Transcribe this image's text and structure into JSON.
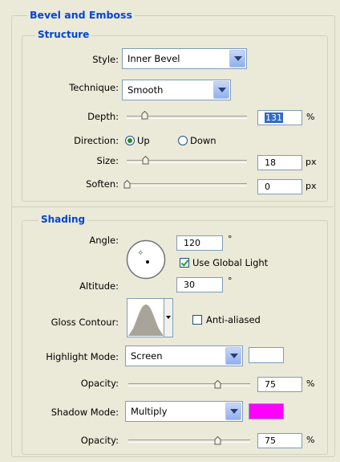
{
  "bevel": {
    "title": "Bevel and Emboss",
    "structure": {
      "title": "Structure",
      "style": {
        "label": "Style:",
        "value": "Inner Bevel"
      },
      "technique": {
        "label": "Technique:",
        "value": "Smooth"
      },
      "depth": {
        "label": "Depth:",
        "value": "131",
        "unit": "%",
        "slider_fraction": 0.2
      },
      "direction": {
        "label": "Direction:",
        "up": "Up",
        "down": "Down",
        "selected": "Up"
      },
      "size": {
        "label": "Size:",
        "value": "18",
        "unit": "px",
        "slider_fraction": 0.1
      },
      "soften": {
        "label": "Soften:",
        "value": "0",
        "unit": "px",
        "slider_fraction": 0.0
      }
    },
    "shading": {
      "title": "Shading",
      "angle": {
        "label": "Angle:",
        "value": "120",
        "unit": "°"
      },
      "use_global_light": {
        "label": "Use Global Light",
        "checked": true
      },
      "altitude": {
        "label": "Altitude:",
        "value": "30",
        "unit": "°"
      },
      "gloss_contour": {
        "label": "Gloss Contour:"
      },
      "anti_aliased": {
        "label": "Anti-aliased",
        "checked": false
      },
      "highlight_mode": {
        "label": "Highlight Mode:",
        "value": "Screen",
        "color": "#ffffff"
      },
      "highlight_opacity": {
        "label": "Opacity:",
        "value": "75",
        "unit": "%",
        "slider_fraction": 0.75
      },
      "shadow_mode": {
        "label": "Shadow Mode:",
        "value": "Multiply",
        "color": "#ff00ff"
      },
      "shadow_opacity": {
        "label": "Opacity:",
        "value": "75",
        "unit": "%",
        "slider_fraction": 0.75
      }
    }
  }
}
